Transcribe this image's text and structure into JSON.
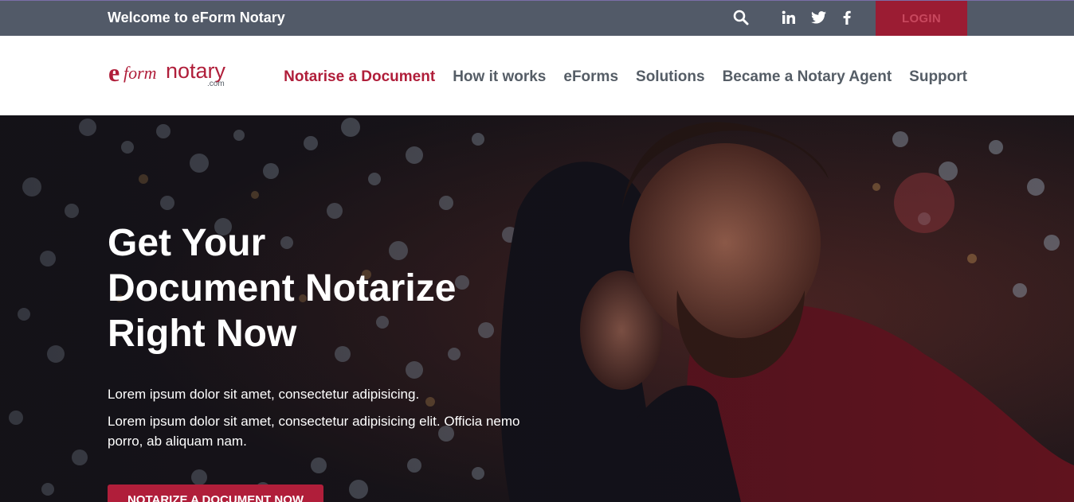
{
  "topbar": {
    "welcome": "Welcome to eForm Notary",
    "icons": [
      "search-icon",
      "linkedin-icon",
      "twitter-icon",
      "facebook-icon"
    ],
    "login_label": "LOGIN"
  },
  "header": {
    "logo_text_e": "e",
    "logo_text_form": "form",
    "logo_text_notary": "notary",
    "logo_text_com": ".com",
    "nav": [
      {
        "label": "Notarise a Document",
        "active": true
      },
      {
        "label": "How it works",
        "active": false
      },
      {
        "label": "eForms",
        "active": false
      },
      {
        "label": "Solutions",
        "active": false
      },
      {
        "label": "Became a Notary Agent",
        "active": false
      },
      {
        "label": "Support",
        "active": false
      }
    ]
  },
  "hero": {
    "title_lines": [
      "Get Your",
      "Document Notarize",
      "Right Now"
    ],
    "paragraph1": "Lorem ipsum dolor sit amet, consectetur adipisicing.",
    "paragraph2": "Lorem ipsum dolor sit amet, consectetur adipisicing elit. Officia nemo porro, ab aliquam nam.",
    "cta_label": "NOTARIZE A DOCUMENT NOW"
  },
  "colors": {
    "topbar_bg": "#525a68",
    "brand_red": "#b01e3a",
    "login_bg": "#9b1c33",
    "nav_text": "#555d66"
  }
}
